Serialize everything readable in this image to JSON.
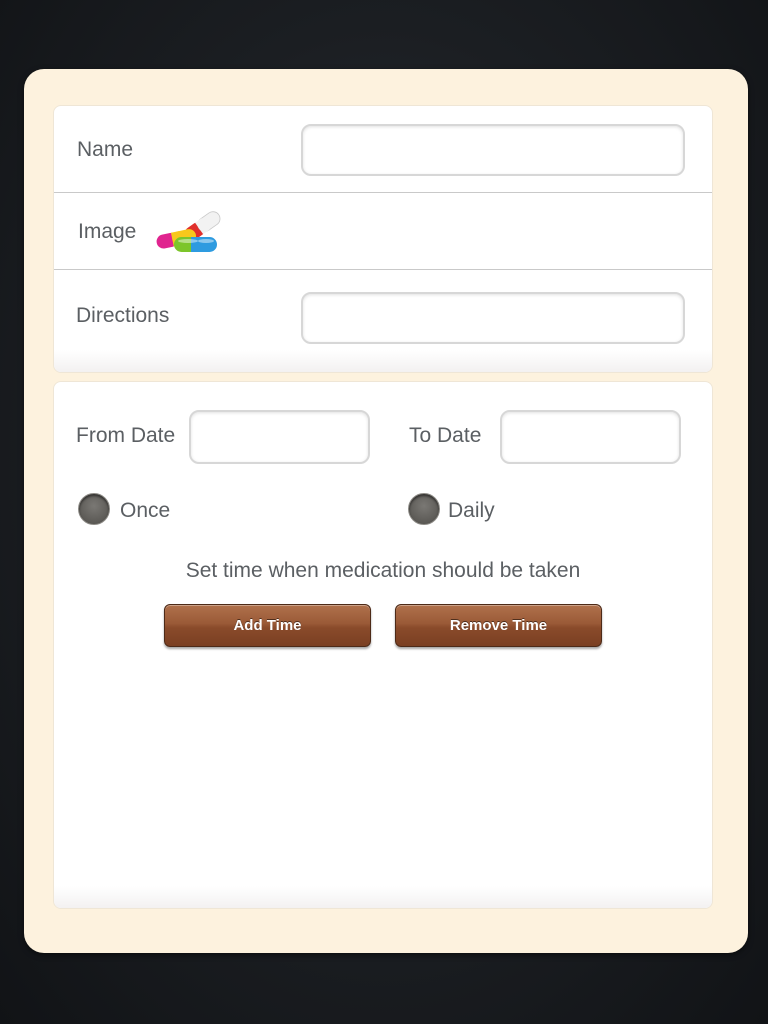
{
  "form": {
    "name_label": "Name",
    "name_value": "",
    "image_label": "Image",
    "image_icon": "pills-icon",
    "directions_label": "Directions",
    "directions_value": ""
  },
  "schedule": {
    "from_date_label": "From Date",
    "from_date_value": "",
    "to_date_label": "To Date",
    "to_date_value": "",
    "frequency_options": [
      {
        "label": "Once",
        "selected": false
      },
      {
        "label": "Daily",
        "selected": false
      }
    ],
    "hint": "Set time when medication should be taken",
    "add_time_label": "Add Time",
    "remove_time_label": "Remove Time"
  },
  "colors": {
    "card_background": "#fdf2de",
    "button_brown": "#9a5a37",
    "label_gray": "#5b5f63"
  }
}
